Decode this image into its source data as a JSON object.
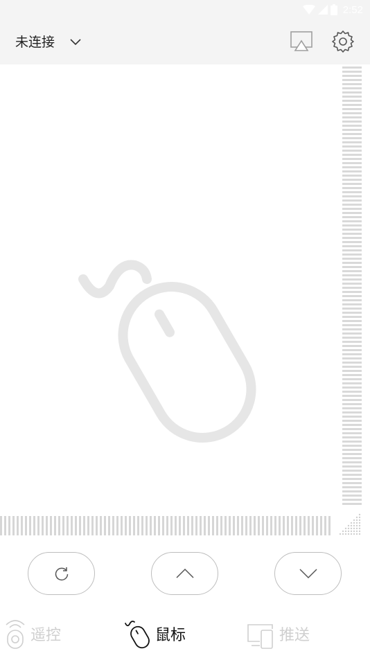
{
  "status_bar": {
    "time": "2:52",
    "icons": [
      "wifi-icon",
      "cell-signal-icon",
      "battery-icon"
    ]
  },
  "app_bar": {
    "connection_label": "未连接",
    "dropdown_icon": "chevron-down-icon",
    "cast_icon": "screen-cast-icon",
    "settings_icon": "gear-icon"
  },
  "touchpad": {
    "watermark_icon": "mouse-icon"
  },
  "controls": {
    "refresh_icon": "refresh-icon",
    "up_icon": "chevron-up-icon",
    "down_icon": "chevron-down-icon"
  },
  "bottom_nav": {
    "items": [
      {
        "label": "遥控",
        "icon": "remote-icon",
        "active": false
      },
      {
        "label": "鼠标",
        "icon": "mouse-icon",
        "active": true
      },
      {
        "label": "推送",
        "icon": "devices-icon",
        "active": false
      }
    ]
  },
  "colors": {
    "top_bar_bg": "#f4f4f4",
    "active_text": "#111111",
    "inactive_text": "#cfcfcf",
    "watermark": "#e6e6e6"
  }
}
